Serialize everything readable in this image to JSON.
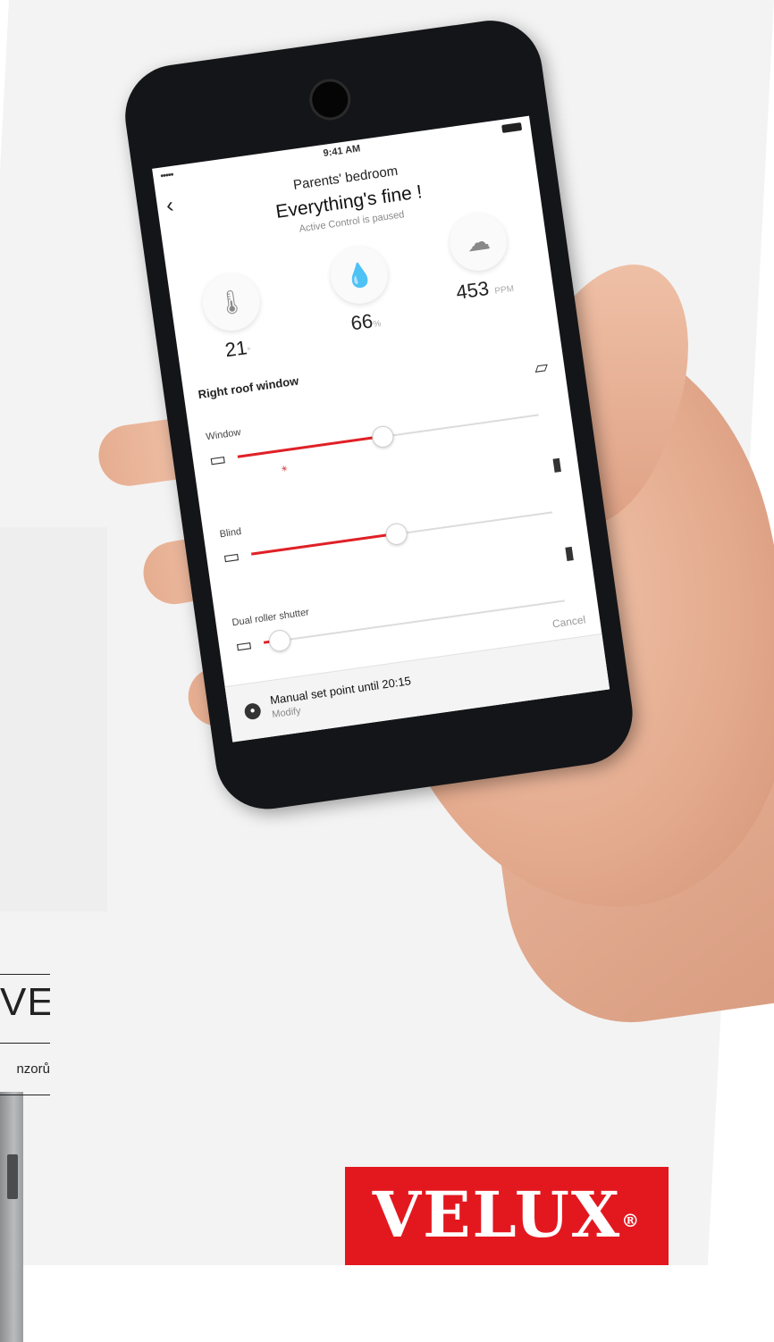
{
  "side": {
    "title_fragment": "VE",
    "text_fragment": "nzorů"
  },
  "phone": {
    "status_time": "9:41 AM",
    "status_signal": "•••••",
    "back_glyph": "‹",
    "room_title": "Parents' bedroom",
    "state_title": "Everything's fine !",
    "state_subtitle": "Active Control is paused",
    "metrics": [
      {
        "name": "temperature",
        "icon": "thermometer-icon",
        "glyph": "🌡",
        "value": "21",
        "unit": "°"
      },
      {
        "name": "humidity",
        "icon": "droplet-icon",
        "glyph": "💧",
        "value": "66",
        "unit": "%"
      },
      {
        "name": "co2",
        "icon": "cloud-co2-icon",
        "glyph": "☁",
        "value": "453",
        "unit": "PPM"
      }
    ],
    "section_title": "Right roof window",
    "controls": [
      {
        "label": "Window",
        "level": 0.48
      },
      {
        "label": "Blind",
        "level": 0.48
      },
      {
        "label": "Dual roller shutter",
        "level": 0.05
      }
    ],
    "cancel_label": "Cancel",
    "bottom_message": "Manual set point until 20:15",
    "bottom_action": "Modify"
  },
  "logo": {
    "text": "VELUX",
    "reg_mark": "®",
    "color": "#e3181f"
  }
}
